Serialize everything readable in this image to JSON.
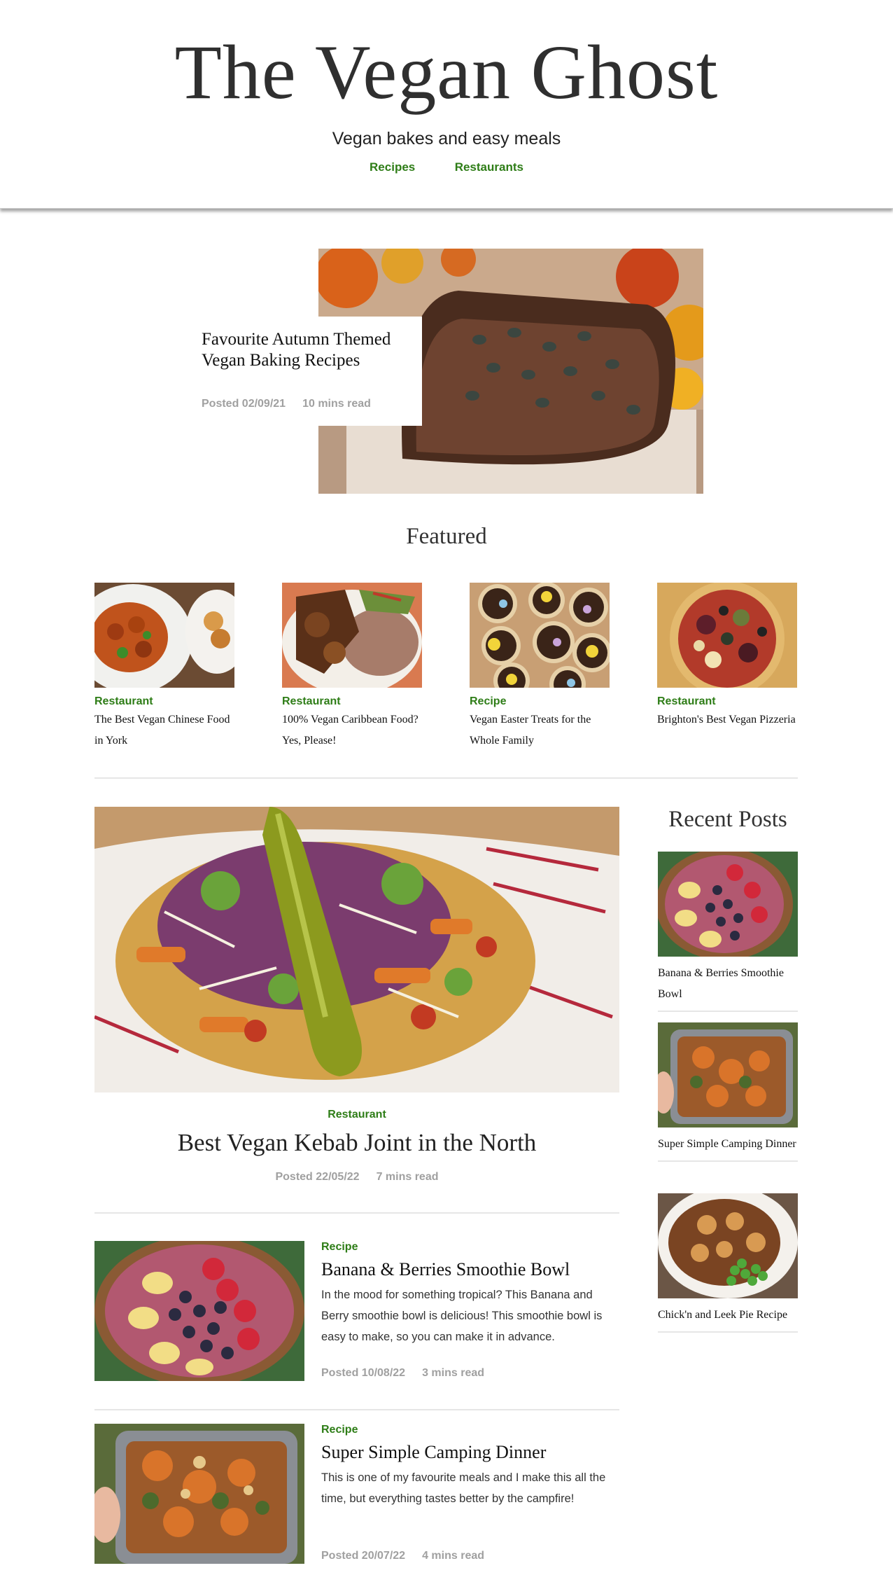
{
  "site": {
    "title": "The Vegan Ghost",
    "tagline": "Vegan bakes and easy meals",
    "nav": [
      "Recipes",
      "Restaurants"
    ]
  },
  "hero": {
    "title": "Favourite Autumn Themed Vegan Baking Recipes",
    "posted": "Posted 02/09/21",
    "read_time": "10 mins read"
  },
  "featured": {
    "heading": "Featured",
    "items": [
      {
        "category": "Restaurant",
        "title": "The Best Vegan Chinese Food in York"
      },
      {
        "category": "Restaurant",
        "title": "100% Vegan Caribbean Food? Yes, Please!"
      },
      {
        "category": "Recipe",
        "title": "Vegan Easter Treats for the Whole Family"
      },
      {
        "category": "Restaurant",
        "title": "Brighton's Best Vegan Pizzeria"
      }
    ]
  },
  "main_post": {
    "category": "Restaurant",
    "title": "Best Vegan Kebab Joint in the North",
    "posted": "Posted 22/05/22",
    "read_time": "7 mins read"
  },
  "posts": [
    {
      "category": "Recipe",
      "title": "Banana & Berries Smoothie Bowl",
      "excerpt": "In the mood for something tropical? This Banana and Berry smoothie bowl is delicious! This smoothie bowl is easy to make, so you can make it in advance.",
      "posted": "Posted 10/08/22",
      "read_time": "3 mins read"
    },
    {
      "category": "Recipe",
      "title": "Super Simple Camping Dinner",
      "excerpt": "This is one of my favourite meals and I make this all the time, but everything tastes better by the campfire!",
      "posted": "Posted 20/07/22",
      "read_time": "4 mins read"
    }
  ],
  "sidebar": {
    "heading": "Recent Posts",
    "items": [
      {
        "title": "Banana & Berries Smoothie Bowl"
      },
      {
        "title": "Super Simple Camping Dinner"
      },
      {
        "title": "Chick'n and Leek Pie Recipe"
      }
    ]
  },
  "colors": {
    "accent": "#2e7d17",
    "meta": "#a0a0a0",
    "title": "#2f2f2f"
  }
}
